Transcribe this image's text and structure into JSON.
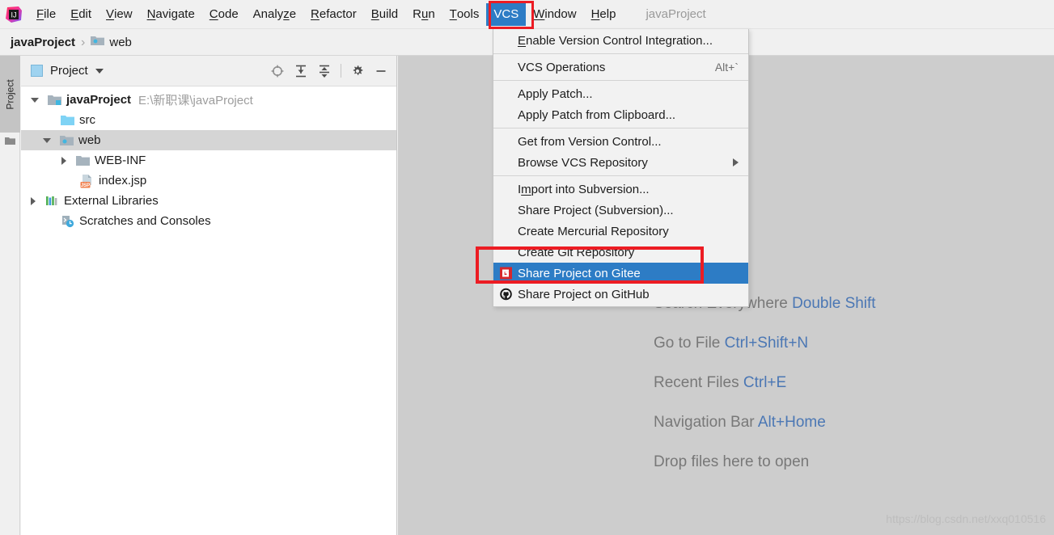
{
  "app": {
    "window_title": "javaProject",
    "logo_icon": "intellij-idea-logo"
  },
  "menubar": {
    "items": [
      {
        "label": "File",
        "mnemonic": "F"
      },
      {
        "label": "Edit",
        "mnemonic": "E"
      },
      {
        "label": "View",
        "mnemonic": "V"
      },
      {
        "label": "Navigate",
        "mnemonic": "N"
      },
      {
        "label": "Code",
        "mnemonic": "C"
      },
      {
        "label": "Analyze",
        "mnemonic": "z"
      },
      {
        "label": "Refactor",
        "mnemonic": "R"
      },
      {
        "label": "Build",
        "mnemonic": "B"
      },
      {
        "label": "Run",
        "mnemonic": "u"
      },
      {
        "label": "Tools",
        "mnemonic": "T"
      },
      {
        "label": "VCS",
        "mnemonic": "",
        "active": true
      },
      {
        "label": "Window",
        "mnemonic": "W"
      },
      {
        "label": "Help",
        "mnemonic": "H"
      }
    ]
  },
  "breadcrumb": {
    "root": "javaProject",
    "separator": "›",
    "leaf": "web",
    "leaf_icon": "web-folder-icon"
  },
  "toolstrip": {
    "project_tab_label": "Project",
    "folder_icon": "folder-icon"
  },
  "project_panel": {
    "header": {
      "title": "Project",
      "view_icon": "project-view-icon",
      "dropdown_icon": "chevron-down-icon",
      "actions": [
        {
          "name": "locate-in-tree-icon",
          "title": "Select Opened File"
        },
        {
          "name": "expand-all-icon",
          "title": "Expand All"
        },
        {
          "name": "collapse-all-icon",
          "title": "Collapse All"
        },
        {
          "name": "gear-icon",
          "title": "Settings"
        },
        {
          "name": "minimize-icon",
          "title": "Hide"
        }
      ]
    },
    "tree": [
      {
        "label": "javaProject",
        "path": "E:\\新职课\\javaProject",
        "icon": "module-folder-icon",
        "twisty": "expanded",
        "depth": 0,
        "bold": true,
        "selected": false
      },
      {
        "label": "src",
        "path": "",
        "icon": "source-folder-icon",
        "twisty": "none",
        "depth": 1,
        "bold": false,
        "selected": false
      },
      {
        "label": "web",
        "path": "",
        "icon": "web-folder-icon",
        "twisty": "expanded",
        "depth": 1,
        "bold": false,
        "selected": true
      },
      {
        "label": "WEB-INF",
        "path": "",
        "icon": "plain-folder-icon",
        "twisty": "collapsed",
        "depth": 2,
        "bold": false,
        "selected": false
      },
      {
        "label": "index.jsp",
        "path": "",
        "icon": "jsp-file-icon",
        "twisty": "none",
        "depth": 2,
        "bold": false,
        "selected": false
      },
      {
        "label": "External Libraries",
        "path": "",
        "icon": "external-libraries-icon",
        "twisty": "collapsed",
        "depth": 0,
        "bold": false,
        "selected": false
      },
      {
        "label": "Scratches and Consoles",
        "path": "",
        "icon": "scratches-icon",
        "twisty": "none",
        "depth": 0,
        "bold": false,
        "selected": false
      }
    ]
  },
  "vcs_menu": {
    "groups": [
      [
        {
          "label": "Enable Version Control Integration...",
          "mnemonic": "E",
          "accel": "",
          "icon": "",
          "submenu": false,
          "highlight": false
        }
      ],
      [
        {
          "label": "VCS Operations",
          "mnemonic": "",
          "accel": "Alt+`",
          "icon": "",
          "submenu": false,
          "highlight": false
        }
      ],
      [
        {
          "label": "Apply Patch...",
          "mnemonic": "",
          "accel": "",
          "icon": "",
          "submenu": false,
          "highlight": false
        },
        {
          "label": "Apply Patch from Clipboard...",
          "mnemonic": "",
          "accel": "",
          "icon": "",
          "submenu": false,
          "highlight": false
        }
      ],
      [
        {
          "label": "Get from Version Control...",
          "mnemonic": "",
          "accel": "",
          "icon": "",
          "submenu": false,
          "highlight": false
        },
        {
          "label": "Browse VCS Repository",
          "mnemonic": "",
          "accel": "",
          "icon": "",
          "submenu": true,
          "highlight": false
        }
      ],
      [
        {
          "label": "Import into Subversion...",
          "mnemonic": "m",
          "accel": "",
          "icon": "",
          "submenu": false,
          "highlight": false
        },
        {
          "label": "Share Project (Subversion)...",
          "mnemonic": "",
          "accel": "",
          "icon": "",
          "submenu": false,
          "highlight": false
        },
        {
          "label": "Create Mercurial Repository",
          "mnemonic": "",
          "accel": "",
          "icon": "",
          "submenu": false,
          "highlight": false
        },
        {
          "label": "Create Git Repository",
          "mnemonic": "",
          "accel": "",
          "icon": "",
          "submenu": false,
          "highlight": false
        },
        {
          "label": "Share Project on Gitee",
          "mnemonic": "",
          "accel": "",
          "icon": "gitee-icon",
          "submenu": false,
          "highlight": true
        },
        {
          "label": "Share Project on GitHub",
          "mnemonic": "",
          "accel": "",
          "icon": "github-icon",
          "submenu": false,
          "highlight": false
        }
      ]
    ]
  },
  "editor": {
    "hints": [
      {
        "text": "Search Everywhere ",
        "key": "Double Shift"
      },
      {
        "text": "Go to File ",
        "key": "Ctrl+Shift+N"
      },
      {
        "text": "Recent Files ",
        "key": "Ctrl+E"
      },
      {
        "text": "Navigation Bar ",
        "key": "Alt+Home"
      },
      {
        "text": "Drop files here to open",
        "key": ""
      }
    ],
    "watermark": "https://blog.csdn.net/xxq010516"
  },
  "annotations": {
    "vcs_box_color": "#ec1c23",
    "gitee_box_color": "#ec1c23",
    "highlight_color": "#2d7cc5"
  }
}
